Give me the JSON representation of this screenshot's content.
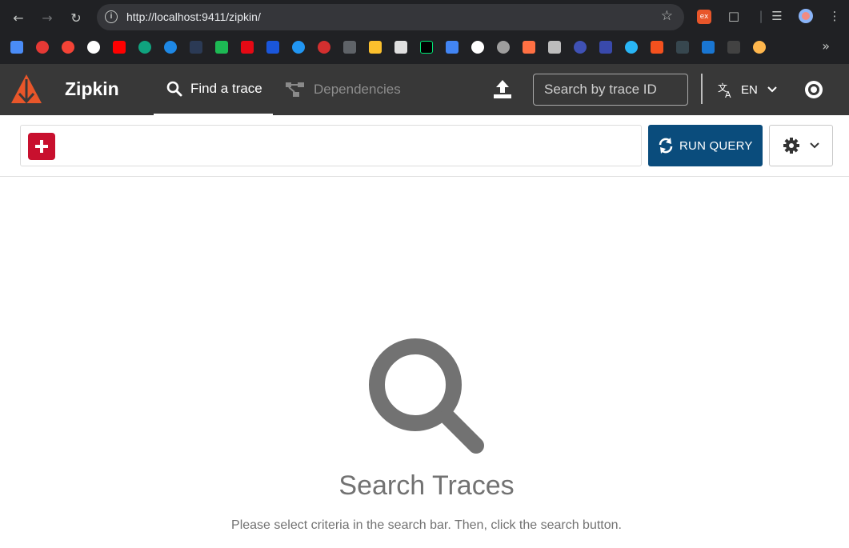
{
  "browser": {
    "url": "http://localhost:9411/zipkin/",
    "back_icon": "arrow-left-icon",
    "forward_icon": "arrow-right-icon",
    "reload_icon": "reload-icon",
    "bookmark_star_icon": "star-icon"
  },
  "header": {
    "brand": "Zipkin",
    "tabs": [
      {
        "label": "Find a trace",
        "icon": "search-icon",
        "active": true
      },
      {
        "label": "Dependencies",
        "icon": "dependencies-icon",
        "active": false
      }
    ],
    "trace_search_placeholder": "Search by trace ID",
    "language": "EN",
    "colors": {
      "background": "#383838",
      "logo": "#e8562a"
    }
  },
  "search_bar": {
    "run_query_label": "RUN QUERY",
    "colors": {
      "add_button": "#c8102e",
      "run_button": "#0a4c7c"
    }
  },
  "main": {
    "empty_title": "Search Traces",
    "empty_subtitle": "Please select criteria in the search bar. Then, click the search button."
  }
}
